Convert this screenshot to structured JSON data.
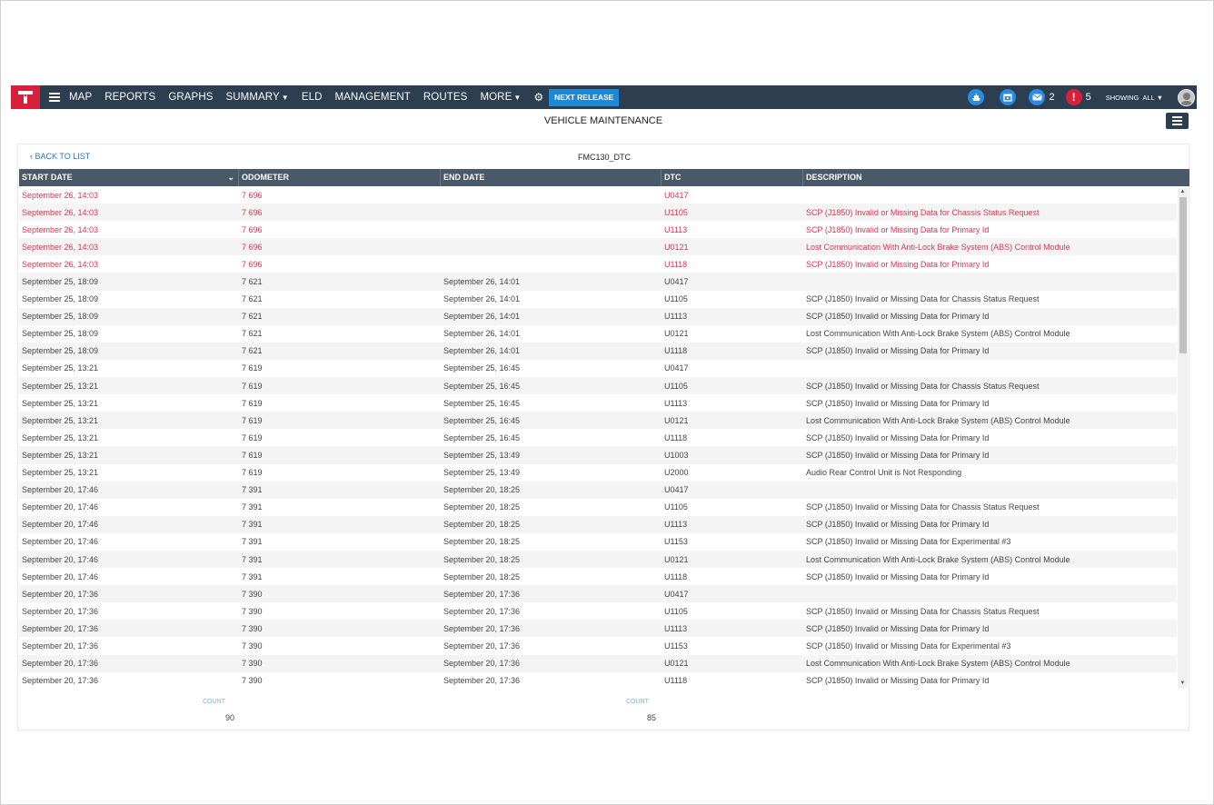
{
  "nav": {
    "items": [
      "MAP",
      "REPORTS",
      "GRAPHS",
      "SUMMARY",
      "ELD",
      "MANAGEMENT",
      "ROUTES",
      "MORE"
    ],
    "release_button": "NEXT RELEASE",
    "messages_count": "2",
    "alerts_count": "5",
    "alerts_glyph": "!",
    "showing_label": "SHOWING",
    "showing_value": "ALL"
  },
  "page": {
    "title": "VEHICLE MAINTENANCE",
    "back_label": "BACK TO LIST",
    "device_name": "FMC130_DTC"
  },
  "table": {
    "columns": [
      "START DATE",
      "ODOMETER",
      "END DATE",
      "DTC",
      "DESCRIPTION"
    ],
    "rows": [
      {
        "start": "September 26, 14:03",
        "odometer": "7 696",
        "end": "",
        "dtc": "U0417",
        "desc": "",
        "alert": true
      },
      {
        "start": "September 26, 14:03",
        "odometer": "7 696",
        "end": "",
        "dtc": "U1105",
        "desc": "SCP (J1850) Invalid or Missing Data for Chassis Status Request",
        "alert": true
      },
      {
        "start": "September 26, 14:03",
        "odometer": "7 696",
        "end": "",
        "dtc": "U1113",
        "desc": "SCP (J1850) Invalid or Missing Data for Primary Id",
        "alert": true
      },
      {
        "start": "September 26, 14:03",
        "odometer": "7 696",
        "end": "",
        "dtc": "U0121",
        "desc": "Lost Communication With Anti-Lock Brake System (ABS) Control Module",
        "alert": true
      },
      {
        "start": "September 26, 14:03",
        "odometer": "7 696",
        "end": "",
        "dtc": "U1118",
        "desc": "SCP (J1850) Invalid or Missing Data for Primary Id",
        "alert": true
      },
      {
        "start": "September 25, 18:09",
        "odometer": "7 621",
        "end": "September 26, 14:01",
        "dtc": "U0417",
        "desc": "",
        "alert": false
      },
      {
        "start": "September 25, 18:09",
        "odometer": "7 621",
        "end": "September 26, 14:01",
        "dtc": "U1105",
        "desc": "SCP (J1850) Invalid or Missing Data for Chassis Status Request",
        "alert": false
      },
      {
        "start": "September 25, 18:09",
        "odometer": "7 621",
        "end": "September 26, 14:01",
        "dtc": "U1113",
        "desc": "SCP (J1850) Invalid or Missing Data for Primary Id",
        "alert": false
      },
      {
        "start": "September 25, 18:09",
        "odometer": "7 621",
        "end": "September 26, 14:01",
        "dtc": "U0121",
        "desc": "Lost Communication With Anti-Lock Brake System (ABS) Control Module",
        "alert": false
      },
      {
        "start": "September 25, 18:09",
        "odometer": "7 621",
        "end": "September 26, 14:01",
        "dtc": "U1118",
        "desc": "SCP (J1850) Invalid or Missing Data for Primary Id",
        "alert": false
      },
      {
        "start": "September 25, 13:21",
        "odometer": "7 619",
        "end": "September 25, 16:45",
        "dtc": "U0417",
        "desc": "",
        "alert": false
      },
      {
        "start": "September 25, 13:21",
        "odometer": "7 619",
        "end": "September 25, 16:45",
        "dtc": "U1105",
        "desc": "SCP (J1850) Invalid or Missing Data for Chassis Status Request",
        "alert": false
      },
      {
        "start": "September 25, 13:21",
        "odometer": "7 619",
        "end": "September 25, 16:45",
        "dtc": "U1113",
        "desc": "SCP (J1850) Invalid or Missing Data for Primary Id",
        "alert": false
      },
      {
        "start": "September 25, 13:21",
        "odometer": "7 619",
        "end": "September 25, 16:45",
        "dtc": "U0121",
        "desc": "Lost Communication With Anti-Lock Brake System (ABS) Control Module",
        "alert": false
      },
      {
        "start": "September 25, 13:21",
        "odometer": "7 619",
        "end": "September 25, 16:45",
        "dtc": "U1118",
        "desc": "SCP (J1850) Invalid or Missing Data for Primary Id",
        "alert": false
      },
      {
        "start": "September 25, 13:21",
        "odometer": "7 619",
        "end": "September 25, 13:49",
        "dtc": "U1003",
        "desc": "SCP (J1850) Invalid or Missing Data for Primary Id",
        "alert": false
      },
      {
        "start": "September 25, 13:21",
        "odometer": "7 619",
        "end": "September 25, 13:49",
        "dtc": "U2000",
        "desc": "Audio Rear Control Unit is Not Responding",
        "alert": false
      },
      {
        "start": "September 20, 17:46",
        "odometer": "7 391",
        "end": "September 20, 18:25",
        "dtc": "U0417",
        "desc": "",
        "alert": false
      },
      {
        "start": "September 20, 17:46",
        "odometer": "7 391",
        "end": "September 20, 18:25",
        "dtc": "U1105",
        "desc": "SCP (J1850) Invalid or Missing Data for Chassis Status Request",
        "alert": false
      },
      {
        "start": "September 20, 17:46",
        "odometer": "7 391",
        "end": "September 20, 18:25",
        "dtc": "U1113",
        "desc": "SCP (J1850) Invalid or Missing Data for Primary Id",
        "alert": false
      },
      {
        "start": "September 20, 17:46",
        "odometer": "7 391",
        "end": "September 20, 18:25",
        "dtc": "U1153",
        "desc": "SCP (J1850) Invalid or Missing Data for Experimental #3",
        "alert": false
      },
      {
        "start": "September 20, 17:46",
        "odometer": "7 391",
        "end": "September 20, 18:25",
        "dtc": "U0121",
        "desc": "Lost Communication With Anti-Lock Brake System (ABS) Control Module",
        "alert": false
      },
      {
        "start": "September 20, 17:46",
        "odometer": "7 391",
        "end": "September 20, 18:25",
        "dtc": "U1118",
        "desc": "SCP (J1850) Invalid or Missing Data for Primary Id",
        "alert": false
      },
      {
        "start": "September 20, 17:36",
        "odometer": "7 390",
        "end": "September 20, 17:36",
        "dtc": "U0417",
        "desc": "",
        "alert": false
      },
      {
        "start": "September 20, 17:36",
        "odometer": "7 390",
        "end": "September 20, 17:36",
        "dtc": "U1105",
        "desc": "SCP (J1850) Invalid or Missing Data for Chassis Status Request",
        "alert": false
      },
      {
        "start": "September 20, 17:36",
        "odometer": "7 390",
        "end": "September 20, 17:36",
        "dtc": "U1113",
        "desc": "SCP (J1850) Invalid or Missing Data for Primary Id",
        "alert": false
      },
      {
        "start": "September 20, 17:36",
        "odometer": "7 390",
        "end": "September 20, 17:36",
        "dtc": "U1153",
        "desc": "SCP (J1850) Invalid or Missing Data for Experimental #3",
        "alert": false
      },
      {
        "start": "September 20, 17:36",
        "odometer": "7 390",
        "end": "September 20, 17:36",
        "dtc": "U0121",
        "desc": "Lost Communication With Anti-Lock Brake System (ABS) Control Module",
        "alert": false
      },
      {
        "start": "September 20, 17:36",
        "odometer": "7 390",
        "end": "September 20, 17:36",
        "dtc": "U1118",
        "desc": "SCP (J1850) Invalid or Missing Data for Primary Id",
        "alert": false
      }
    ]
  },
  "footer": {
    "count_label_1": "COUNT",
    "count_value_1": "90",
    "count_label_2": "COUNT",
    "count_value_2": "85"
  },
  "icons": {
    "logo": "logo-icon",
    "menu": "hamburger-icon",
    "settings": "gear-icon",
    "ship": "ship-icon",
    "calendar": "calendar-icon",
    "messages": "envelope-icon",
    "alerts": "alert-icon",
    "user": "avatar"
  },
  "colors": {
    "navbar": "#2c3e50",
    "logo": "#d6203c",
    "release_button": "#1e88d7",
    "alert_row": "#e2334e",
    "table_header": "#4a5968",
    "link": "#2a73c9"
  }
}
